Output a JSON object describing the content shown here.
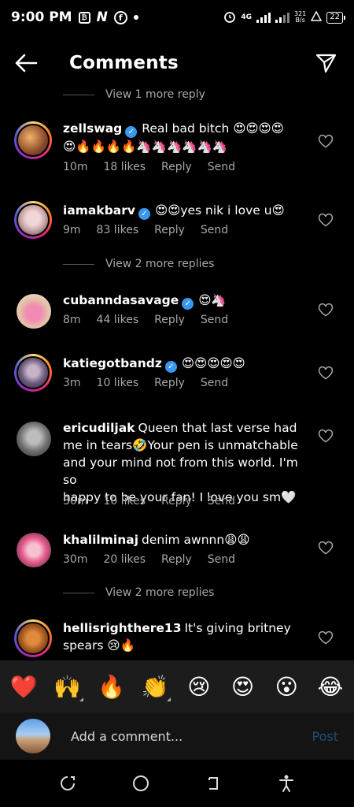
{
  "status_bar": {
    "time": "9:00 PM",
    "network": "4G",
    "speed_top": "321",
    "speed_bottom": "B/s",
    "battery": "22"
  },
  "header": {
    "title": "Comments"
  },
  "thread": [
    {
      "type": "more",
      "text": "View 1 more reply"
    },
    {
      "type": "comment",
      "username": "zellswag",
      "verified": true,
      "text_lines": [
        "Real bad bitch 😍😍😍😍",
        "😍🔥🔥🔥🔥🦄🦄🦄🦄🦄🦄"
      ],
      "time": "10m",
      "likes": "18 likes",
      "reply": "Reply",
      "send": "Send",
      "avatar_icon": "dragon-art-avatar"
    },
    {
      "type": "comment",
      "username": "iamakbarv",
      "verified": true,
      "text_lines": [
        "😍😍yes nik i love u😍"
      ],
      "time": "9m",
      "likes": "83 likes",
      "reply": "Reply",
      "send": "Send",
      "avatar_icon": "pink-hair-avatar"
    },
    {
      "type": "more",
      "text": "View 2 more replies"
    },
    {
      "type": "comment",
      "username": "cubanndasavage",
      "verified": true,
      "text_lines": [
        "😍🦄"
      ],
      "time": "8m",
      "likes": "44 likes",
      "reply": "Reply",
      "send": "Send",
      "avatar_icon": "pink-outfit-avatar"
    },
    {
      "type": "comment",
      "username": "katiegotbandz",
      "verified": true,
      "text_lines": [
        "😍😍😍😍😍"
      ],
      "time": "3m",
      "likes": "10 likes",
      "reply": "Reply",
      "send": "Send",
      "avatar_icon": "selfie-avatar"
    },
    {
      "type": "comment",
      "username": "ericudiljak",
      "verified": false,
      "text_lines": [
        "Queen that last verse had",
        "me in tears🤣Your pen is unmatchable",
        "and your mind not from this world. I'm so",
        "happy to be your fan! I love you sm🤍"
      ],
      "time": "30m",
      "likes": "10 likes",
      "reply": "Reply",
      "send": "Send",
      "avatar_icon": "gray-photo-avatar"
    },
    {
      "type": "comment",
      "username": "khalilminaj",
      "verified": false,
      "text_lines": [
        "denim awnnn😩😩"
      ],
      "time": "30m",
      "likes": "20 likes",
      "reply": "Reply",
      "send": "Send",
      "avatar_icon": "pink-wig-avatar"
    },
    {
      "type": "more",
      "text": "View 2 more replies"
    },
    {
      "type": "comment",
      "username": "hellisrighthere13",
      "verified": false,
      "text_lines": [
        "It's giving britney",
        "spears 😢🔥"
      ],
      "time": "",
      "likes": "",
      "reply": "",
      "send": "",
      "avatar_icon": "orange-face-avatar"
    }
  ],
  "emoji_bar": [
    "❤️",
    "🙌",
    "🔥",
    "👏",
    "😢",
    "😍",
    "😮",
    "😂"
  ],
  "composer": {
    "placeholder": "Add a comment...",
    "post_label": "Post",
    "avatar_icon": "building-avatar"
  },
  "colors": {
    "accent": "#3897f0",
    "post_disabled": "#1f4f78",
    "muted": "#a8a8a8"
  }
}
